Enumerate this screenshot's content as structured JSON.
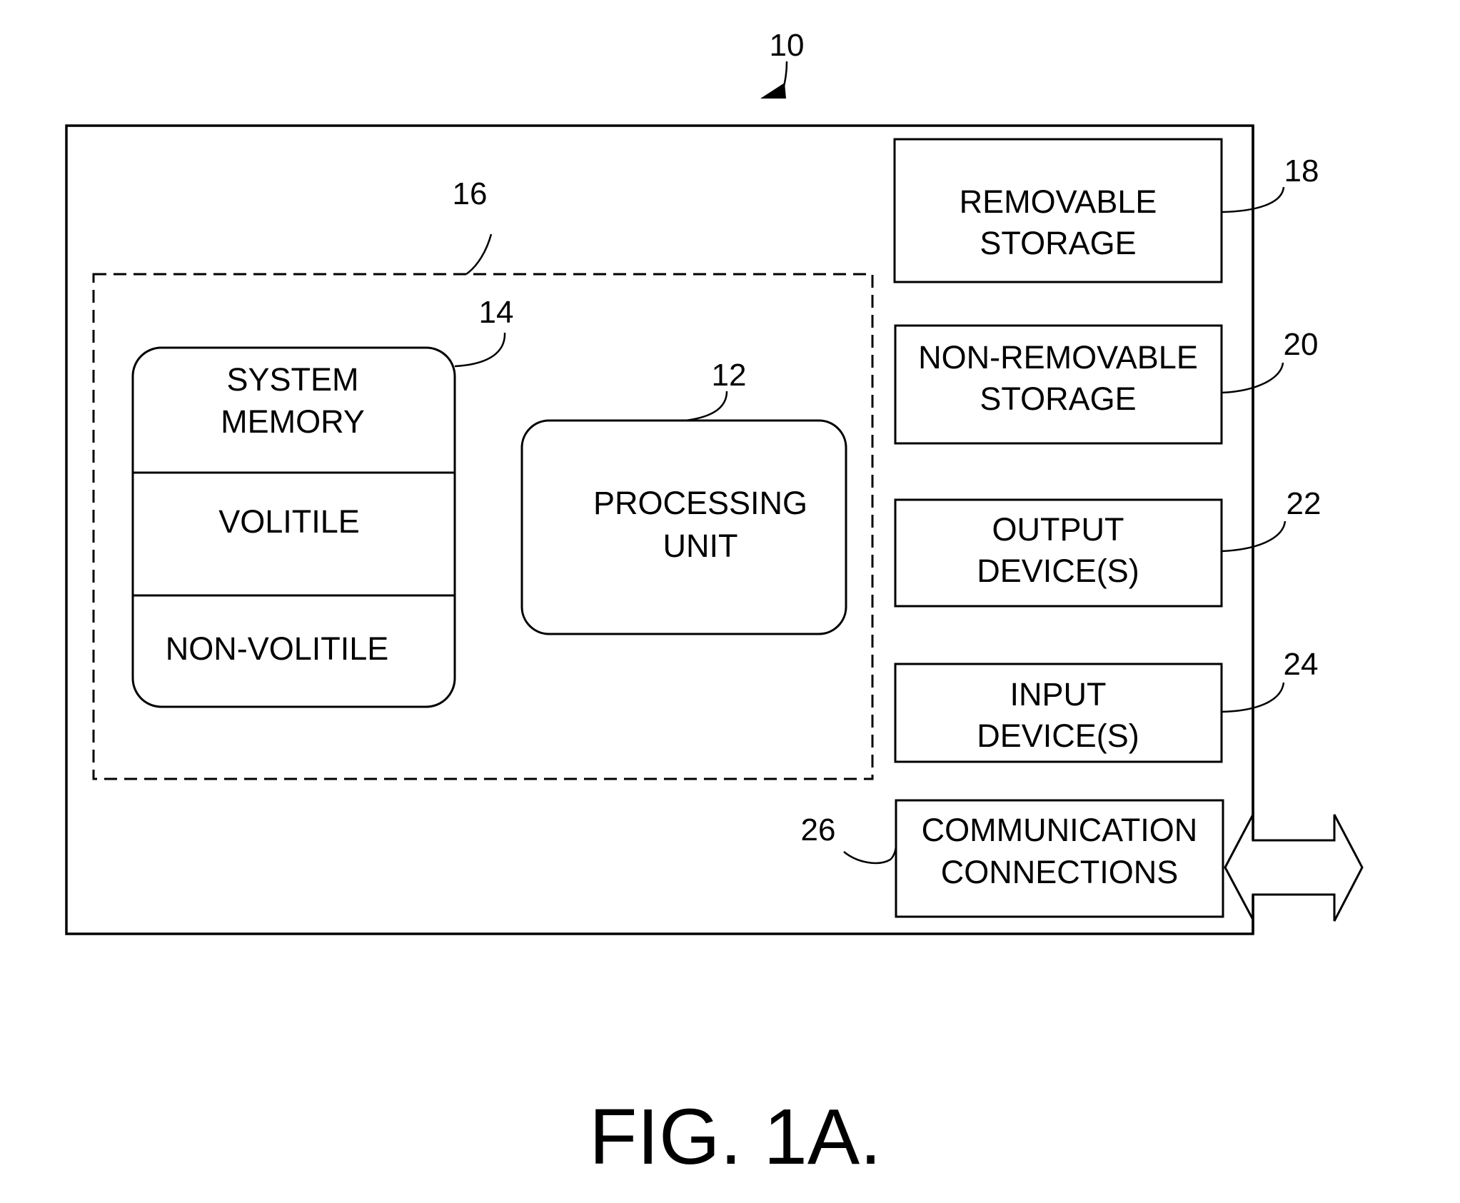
{
  "figure": {
    "caption": "FIG. 1A.",
    "reference": "10"
  },
  "dashed_group": {
    "reference": "16"
  },
  "system_memory": {
    "reference": "14",
    "title_line1": "SYSTEM",
    "title_line2": "MEMORY",
    "section_volatile": "VOLITILE",
    "section_nonvolatile": "NON-VOLITILE"
  },
  "processing_unit": {
    "reference": "12",
    "line1": "PROCESSING",
    "line2": "UNIT"
  },
  "removable_storage": {
    "reference": "18",
    "line1": "REMOVABLE",
    "line2": "STORAGE"
  },
  "non_removable_storage": {
    "reference": "20",
    "line1": "NON-REMOVABLE",
    "line2": "STORAGE"
  },
  "output_devices": {
    "reference": "22",
    "line1": "OUTPUT",
    "line2": "DEVICE(S)"
  },
  "input_devices": {
    "reference": "24",
    "line1": "INPUT",
    "line2": "DEVICE(S)"
  },
  "communication_connections": {
    "reference": "26",
    "line1": "COMMUNICATION",
    "line2": "CONNECTIONS"
  },
  "colors": {
    "ink": "#000000",
    "paper": "#ffffff"
  }
}
